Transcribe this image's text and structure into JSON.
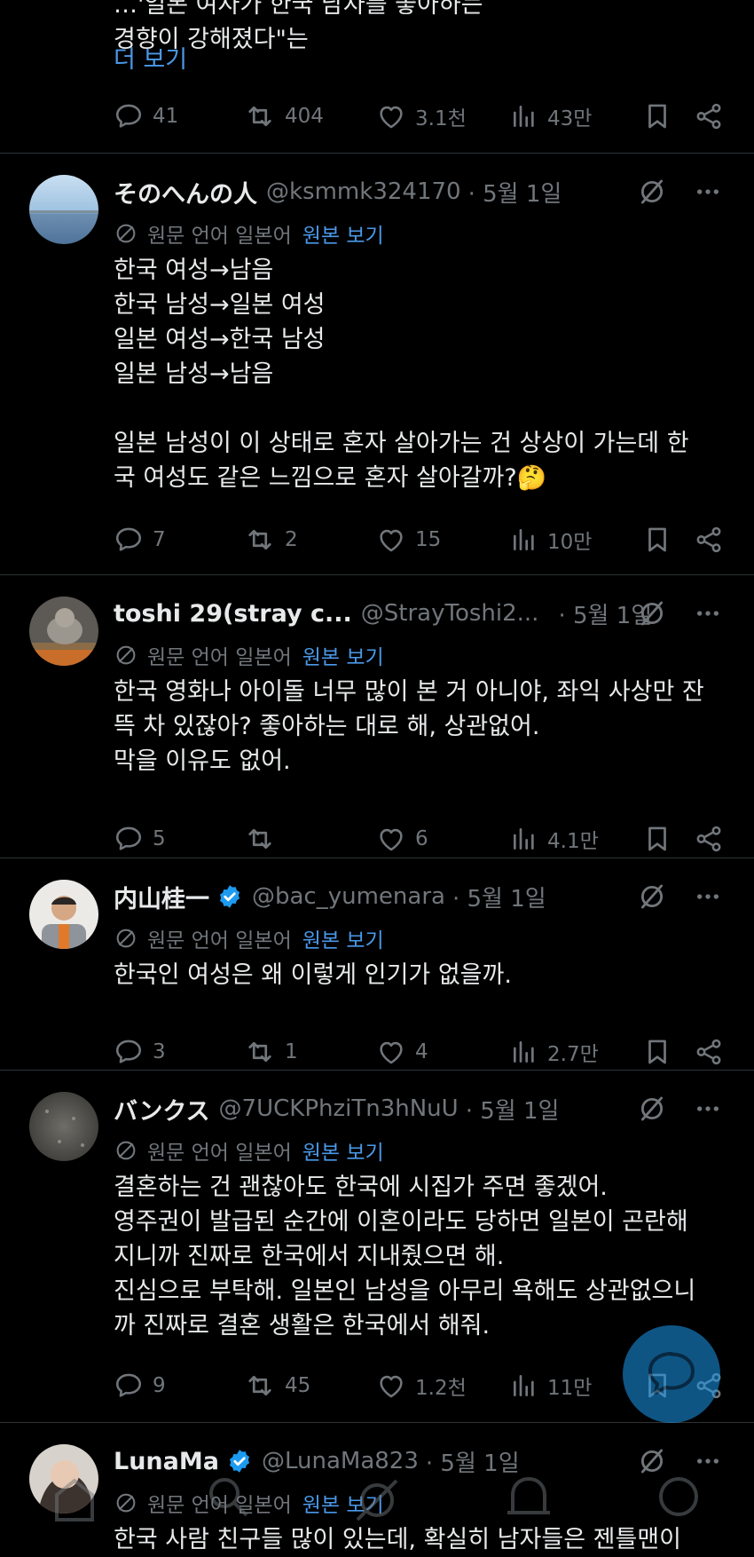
{
  "top_partial": {
    "line1": "…'일본 여자가 한국 남자를 좋아하는",
    "line2": "경향이 강해졌다\"는",
    "more_label": "더 보기",
    "stats": {
      "replies": "41",
      "reposts": "404",
      "likes": "3.1천",
      "views": "43만"
    }
  },
  "translate_note": {
    "label": "원문 언어 일본어",
    "link": "원본 보기"
  },
  "posts": [
    {
      "name": "そのへんの人",
      "handle": "@ksmmk324170",
      "date": "· 5월 1일",
      "verified": false,
      "lines": [
        "한국 여성→남음",
        "한국 남성→일본 여성",
        "일본 여성→한국 남성",
        "일본 남성→남음",
        "",
        "일본 남성이 이 상태로 혼자 살아가는 건 상상이 가는데 한",
        "국 여성도 같은 느낌으로 혼자 살아갈까?🤔"
      ],
      "stats": {
        "replies": "7",
        "reposts": "2",
        "likes": "15",
        "views": "10만"
      }
    },
    {
      "name": "toshi 29(stray c...",
      "handle": "@StrayToshi2...",
      "date": "· 5월 1일",
      "verified": false,
      "lines": [
        "한국 영화나 아이돌 너무 많이 본 거 아니야, 좌익 사상만 잔",
        "뜩 차 있잖아? 좋아하는 대로 해, 상관없어.",
        "막을 이유도 없어."
      ],
      "stats": {
        "replies": "5",
        "reposts": "",
        "likes": "6",
        "views": "4.1만"
      }
    },
    {
      "name": "内山桂一",
      "handle": "@bac_yumenara",
      "date": "· 5월 1일",
      "verified": true,
      "lines": [
        "한국인 여성은 왜 이렇게 인기가 없을까."
      ],
      "stats": {
        "replies": "3",
        "reposts": "1",
        "likes": "4",
        "views": "2.7만"
      }
    },
    {
      "name": "バンクス",
      "handle": "@7UCKPhziTn3hNuU",
      "date": "· 5월 1일",
      "verified": false,
      "lines": [
        "결혼하는 건 괜찮아도 한국에 시집가 주면 좋겠어.",
        "영주권이 발급된 순간에 이혼이라도 당하면 일본이 곤란해",
        "지니까 진짜로 한국에서 지내줬으면 해.",
        "진심으로 부탁해. 일본인 남성을 아무리 욕해도 상관없으니",
        "까 진짜로 결혼 생활은 한국에서 해줘."
      ],
      "stats": {
        "replies": "9",
        "reposts": "45",
        "likes": "1.2천",
        "views": "11만"
      }
    },
    {
      "name": "LunaMa",
      "handle": "@LunaMa823",
      "date": "· 5월 1일",
      "verified": true,
      "lines": [
        "한국 사람 친구들 많이 있는데, 확실히 남자들은 젠틀맨이"
      ],
      "stats": {
        "replies": "",
        "reposts": "",
        "likes": "",
        "views": ""
      }
    }
  ],
  "colors": {
    "background": "#000000",
    "text": "#e7e9ea",
    "muted": "#71767b",
    "link": "#4a99e9",
    "verified": "#1d9bf0",
    "divider": "#2f3336"
  }
}
